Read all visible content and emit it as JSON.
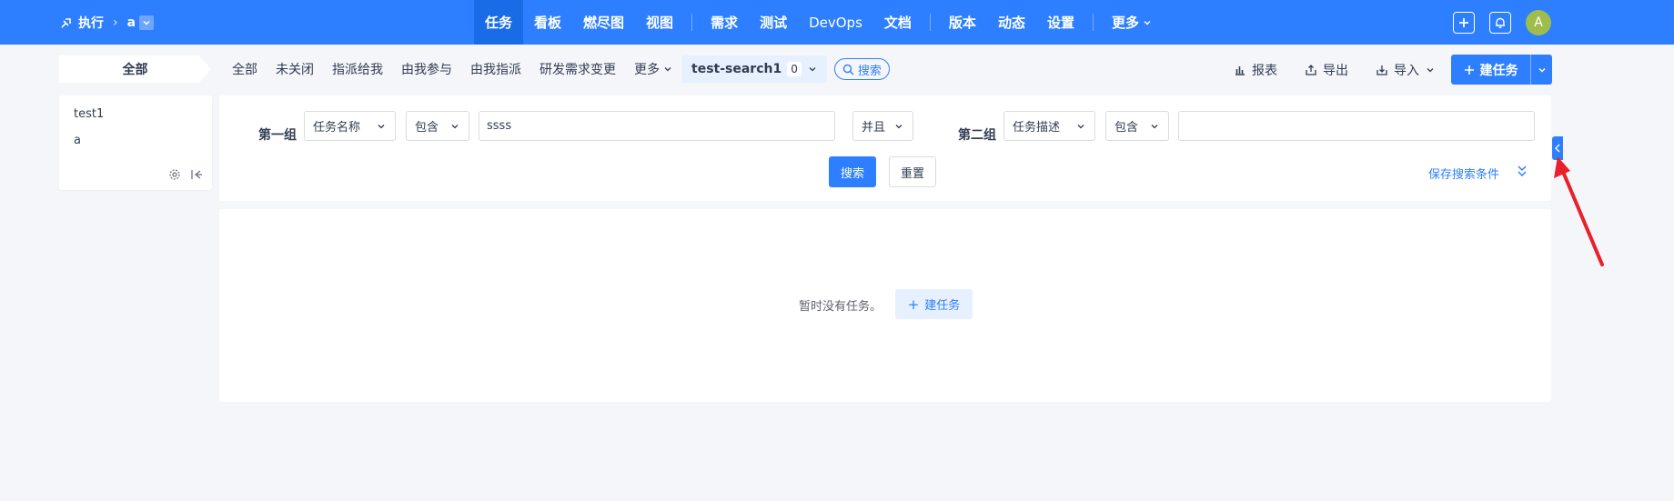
{
  "header": {
    "project_label": "执行",
    "execution_name": "a",
    "nav": [
      {
        "label": "任务",
        "active": true
      },
      {
        "label": "看板"
      },
      {
        "label": "燃尽图"
      },
      {
        "label": "视图"
      },
      {
        "label": "需求"
      },
      {
        "label": "测试"
      },
      {
        "label": "DevOps"
      },
      {
        "label": "文档"
      },
      {
        "label": "版本"
      },
      {
        "label": "动态"
      },
      {
        "label": "设置"
      },
      {
        "label": "更多"
      }
    ],
    "avatar_initial": "A"
  },
  "toolbar": {
    "all_crumb": "全部",
    "filters": [
      "全部",
      "未关闭",
      "指派给我",
      "由我参与",
      "由我指派",
      "研发需求变更"
    ],
    "more_label": "更多",
    "saved_query": {
      "label": "test-search1",
      "count": "0"
    },
    "search_pill": "搜索",
    "report_label": "报表",
    "export_label": "导出",
    "import_label": "导入",
    "create_label": "建任务"
  },
  "sidebar": {
    "items": [
      "test1",
      "a"
    ]
  },
  "search_form": {
    "group1_label": "第一组",
    "group1_field": "任务名称",
    "group1_operator": "包含",
    "group1_value": "ssss",
    "logic": "并且",
    "group2_label": "第二组",
    "group2_field": "任务描述",
    "group2_operator": "包含",
    "group2_value": "",
    "search_button": "搜索",
    "reset_button": "重置",
    "save_label": "保存搜索条件"
  },
  "content": {
    "empty_text": "暂时没有任务。",
    "create_label": "建任务"
  },
  "colors": {
    "primary": "#2e7fff",
    "background": "#f5f6fa",
    "annotation_arrow": "#e8202a"
  }
}
